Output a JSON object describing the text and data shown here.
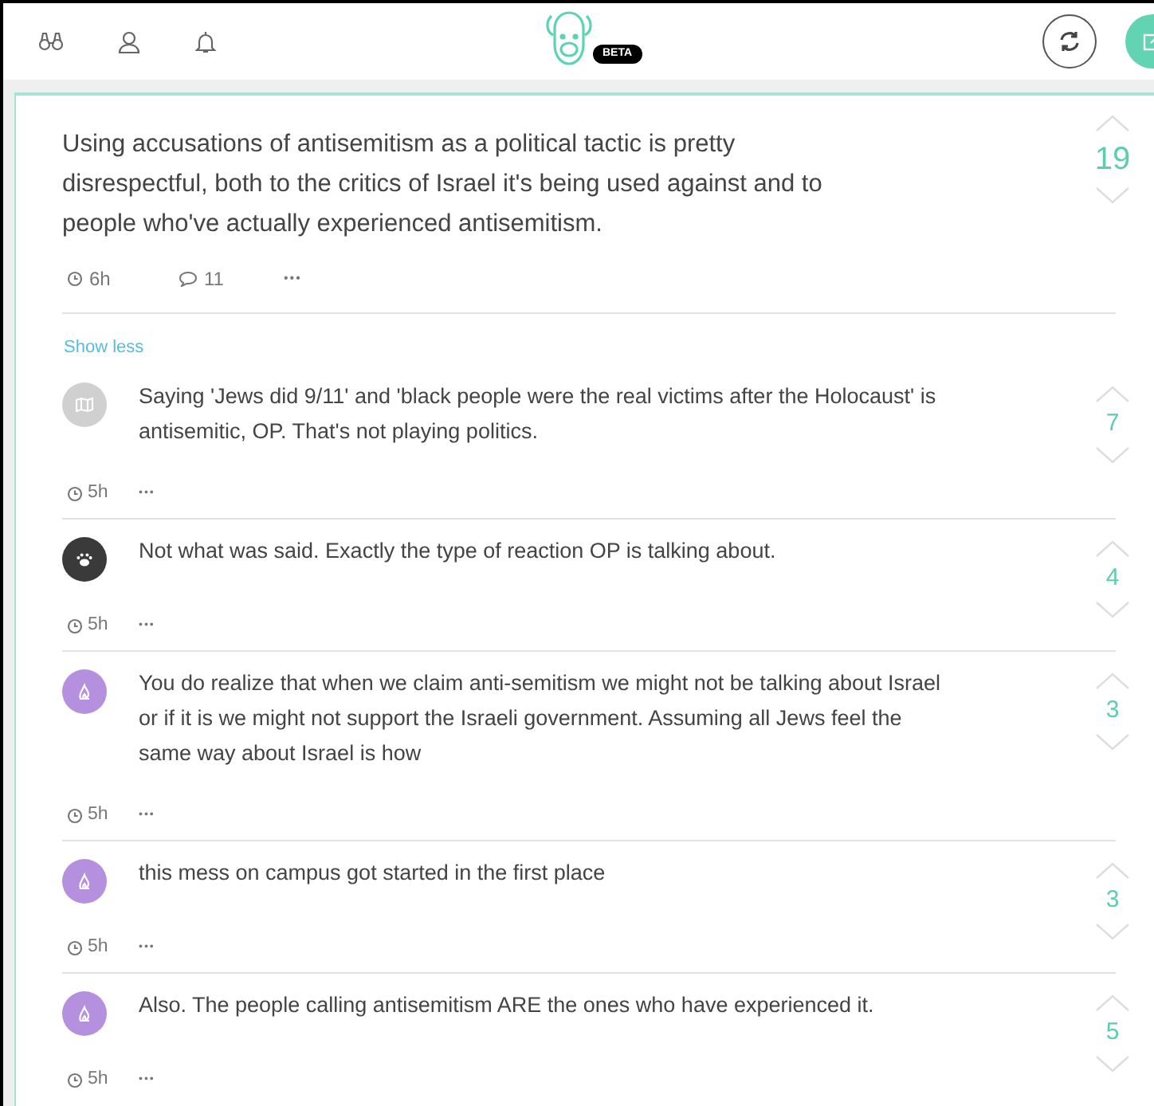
{
  "header": {
    "badge": "BETA"
  },
  "post": {
    "text": "Using accusations of antisemitism as a political tactic is pretty disrespectful, both to the critics of Israel it's being used against and to people who've actually experienced antisemitism.",
    "score": "19",
    "time": "6h",
    "replies": "11",
    "more": "•••"
  },
  "show_less": "Show less",
  "comments": [
    {
      "avatar": {
        "kind": "map",
        "color": "#d0d0d0"
      },
      "text": "Saying 'Jews did 9/11' and 'black people were the real victims after the Holocaust' is antisemitic, OP. That's not playing politics.",
      "score": "7",
      "time": "5h",
      "more": "•••"
    },
    {
      "avatar": {
        "kind": "paw",
        "color": "#3a3a3a"
      },
      "text": "Not what was said. Exactly the type of reaction OP is talking about.",
      "score": "4",
      "time": "5h",
      "more": "•••"
    },
    {
      "avatar": {
        "kind": "fire",
        "color": "#b590de"
      },
      "text": "You do realize that when we claim anti-semitism we might not be talking about Israel or if it is we might not support the Israeli government. Assuming all Jews feel the same way about Israel is how",
      "score": "3",
      "time": "5h",
      "more": "•••"
    },
    {
      "avatar": {
        "kind": "fire",
        "color": "#b590de"
      },
      "text": "this mess on campus got started in the first place",
      "score": "3",
      "time": "5h",
      "more": "•••"
    },
    {
      "avatar": {
        "kind": "fire",
        "color": "#b590de"
      },
      "text": "Also. The people calling antisemitism ARE the ones who have experienced it.",
      "score": "5",
      "time": "5h",
      "more": "•••"
    }
  ]
}
